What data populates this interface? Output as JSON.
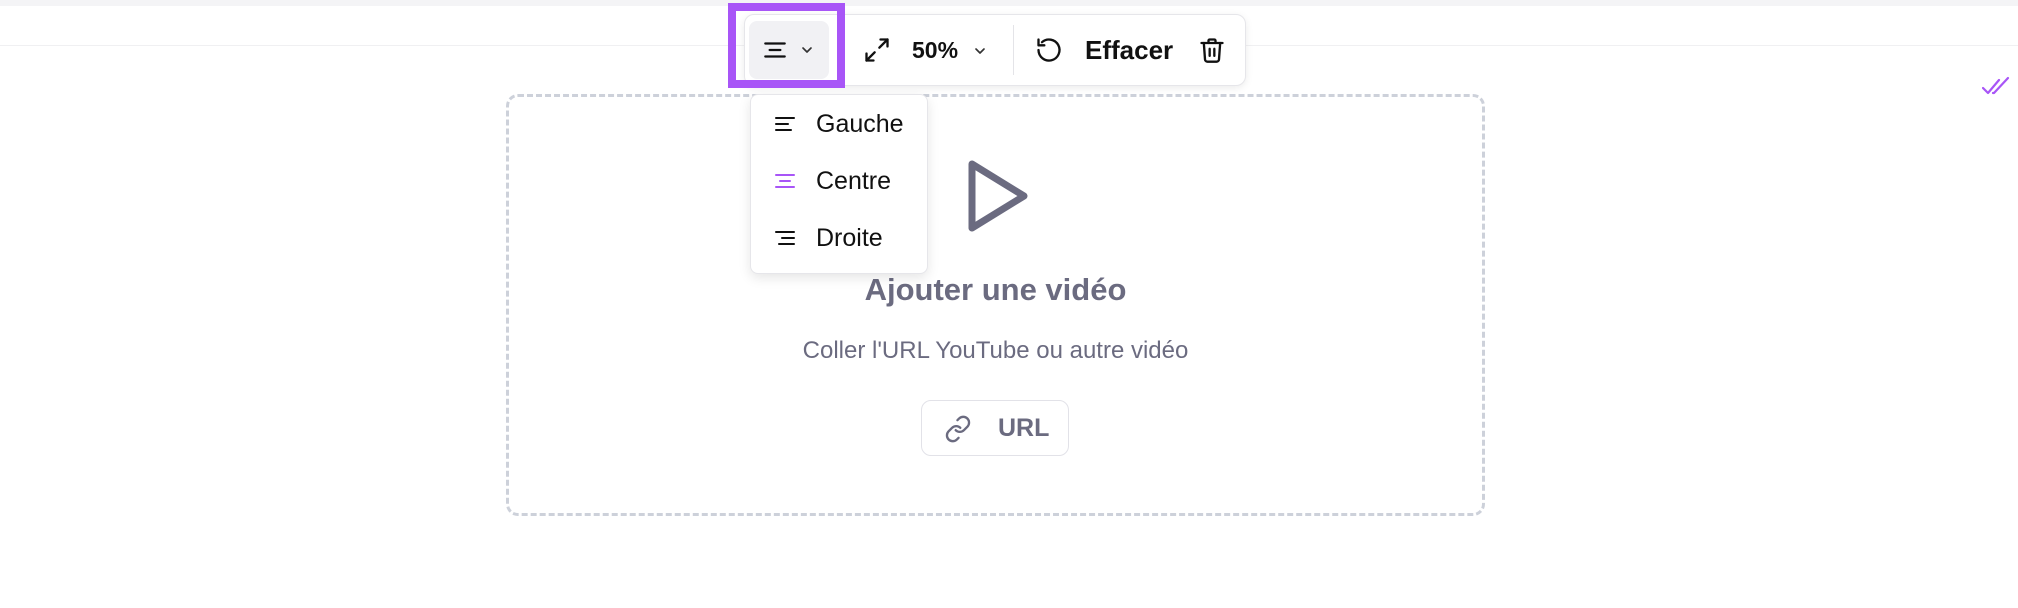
{
  "toolbar": {
    "alignment": {
      "selected": "Centre",
      "icon": "align-center-icon",
      "chevron_icon": "chevron-down-icon"
    },
    "size": {
      "icon": "expand-icon",
      "value": "50%",
      "chevron_icon": "chevron-down-icon"
    },
    "reset": {
      "icon": "rotate-ccw-icon",
      "label": "Effacer"
    },
    "delete": {
      "icon": "trash-icon"
    }
  },
  "alignment_menu": {
    "items": [
      {
        "label": "Gauche",
        "icon": "align-left-icon",
        "selected": false
      },
      {
        "label": "Centre",
        "icon": "align-center-icon",
        "selected": true
      },
      {
        "label": "Droite",
        "icon": "align-right-icon",
        "selected": false
      }
    ]
  },
  "video_block": {
    "icon": "play-icon",
    "title": "Ajouter une vidéo",
    "subtitle": "Coller l'URL YouTube ou autre vidéo",
    "url_button": {
      "icon": "link-icon",
      "label": "URL"
    }
  },
  "status": {
    "icon": "double-check-icon"
  },
  "colors": {
    "accent": "#a855f7",
    "muted_text": "#6b6b80",
    "dashed_border": "#cdd1da"
  }
}
